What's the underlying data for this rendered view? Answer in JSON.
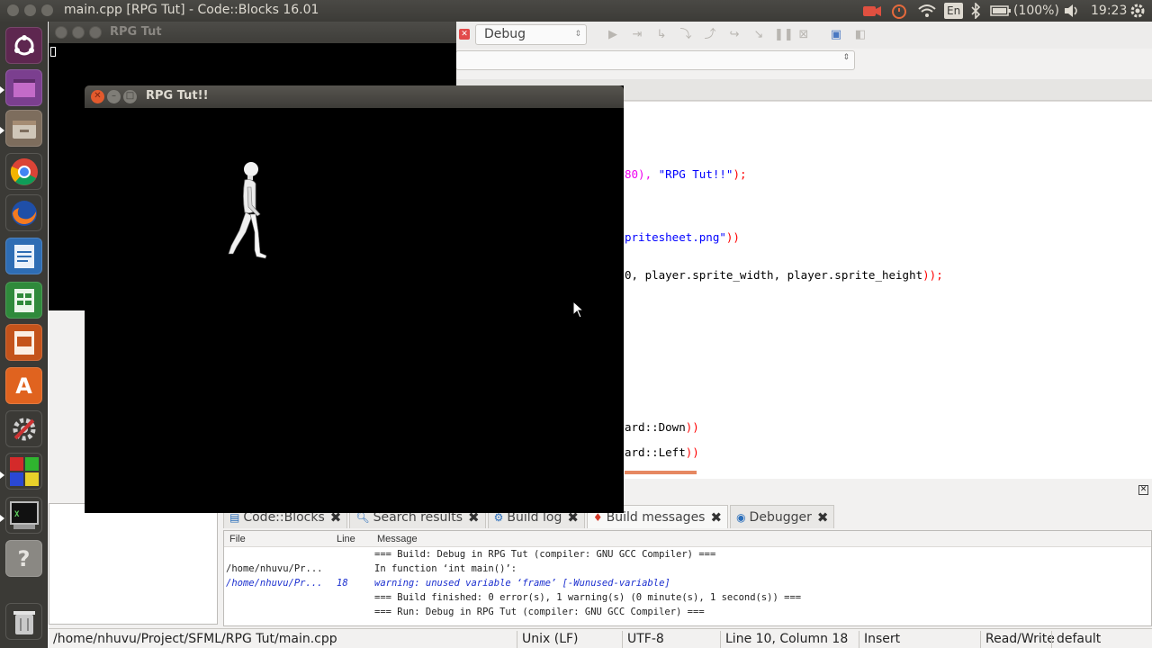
{
  "top_panel": {
    "window_title": "main.cpp [RPG Tut] - Code::Blocks 16.01",
    "keyboard_layout": "En",
    "battery": "(100%)",
    "clock": "19:23"
  },
  "launcher": {
    "items": [
      "dash-icon",
      "workspace-icon",
      "files-icon",
      "chrome-icon",
      "firefox-icon",
      "writer-icon",
      "calc-icon",
      "impress-icon",
      "software-center-icon",
      "settings-icon",
      "codeblocks-icon",
      "xterm-icon",
      "help-icon",
      "trash-icon"
    ]
  },
  "toolbar": {
    "build_target": "Debug"
  },
  "editor": {
    "lines": [
      {
        "pre": "80), ",
        "str": "\"RPG Tut!!\"",
        "post": ");"
      },
      {
        "pre": "",
        "str": "pritesheet.png\"",
        "post": "))"
      },
      {
        "pre": "0, player.sprite_width, player.sprite_height",
        "str": "",
        "post": "));"
      },
      {
        "pre": "ard::Down",
        "str": "",
        "post": "))"
      },
      {
        "pre": "ard::Left",
        "str": "",
        "post": "))"
      }
    ]
  },
  "logs": {
    "tabs": [
      {
        "label": "Code::Blocks",
        "active": false
      },
      {
        "label": "Search results",
        "active": false
      },
      {
        "label": "Build log",
        "active": false
      },
      {
        "label": "Build messages",
        "active": true
      },
      {
        "label": "Debugger",
        "active": false
      }
    ],
    "columns": [
      "File",
      "Line",
      "Message"
    ],
    "rows": [
      {
        "file": "",
        "line": "",
        "message": "=== Build: Debug in RPG Tut (compiler: GNU GCC Compiler) ===",
        "warn": false
      },
      {
        "file": "/home/nhuvu/Pr...",
        "line": "",
        "message": "In function ‘int main()’:",
        "warn": false
      },
      {
        "file": "/home/nhuvu/Pr...",
        "line": "18",
        "message": "warning: unused variable ‘frame’ [-Wunused-variable]",
        "warn": true
      },
      {
        "file": "",
        "line": "",
        "message": "=== Build finished: 0 error(s), 1 warning(s) (0 minute(s), 1 second(s)) ===",
        "warn": false
      },
      {
        "file": "",
        "line": "",
        "message": "=== Run: Debug in RPG Tut (compiler: GNU GCC Compiler) ===",
        "warn": false
      }
    ]
  },
  "status_bar": {
    "path": "/home/nhuvu/Project/SFML/RPG Tut/main.cpp",
    "line_endings": "Unix (LF)",
    "encoding": "UTF-8",
    "position": "Line 10, Column 18",
    "mode": "Insert",
    "access": "Read/Write",
    "lang": "default"
  },
  "console_window": {
    "title": "RPG Tut"
  },
  "game_window": {
    "title": "RPG Tut!!"
  }
}
